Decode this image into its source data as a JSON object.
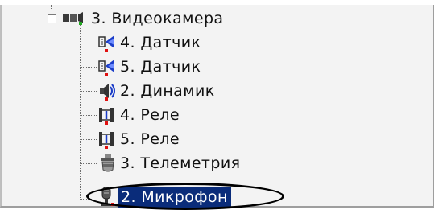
{
  "tree": {
    "items": [
      {
        "label": "3. Видеокамера",
        "icon": "videocamera-icon"
      },
      {
        "label": "4. Датчик",
        "icon": "sensor-icon"
      },
      {
        "label": "5. Датчик",
        "icon": "sensor-icon"
      },
      {
        "label": "2. Динамик",
        "icon": "speaker-icon"
      },
      {
        "label": "4. Реле",
        "icon": "relay-icon"
      },
      {
        "label": "5. Реле",
        "icon": "relay-icon"
      },
      {
        "label": "3. Телеметрия",
        "icon": "telemetry-icon"
      },
      {
        "label": "2. Микрофон",
        "icon": "microphone-icon",
        "selected": true
      }
    ]
  },
  "colors": {
    "selection": "#0a2c7a",
    "status_marker": "#e01010",
    "highlight_oval": "#000000"
  }
}
